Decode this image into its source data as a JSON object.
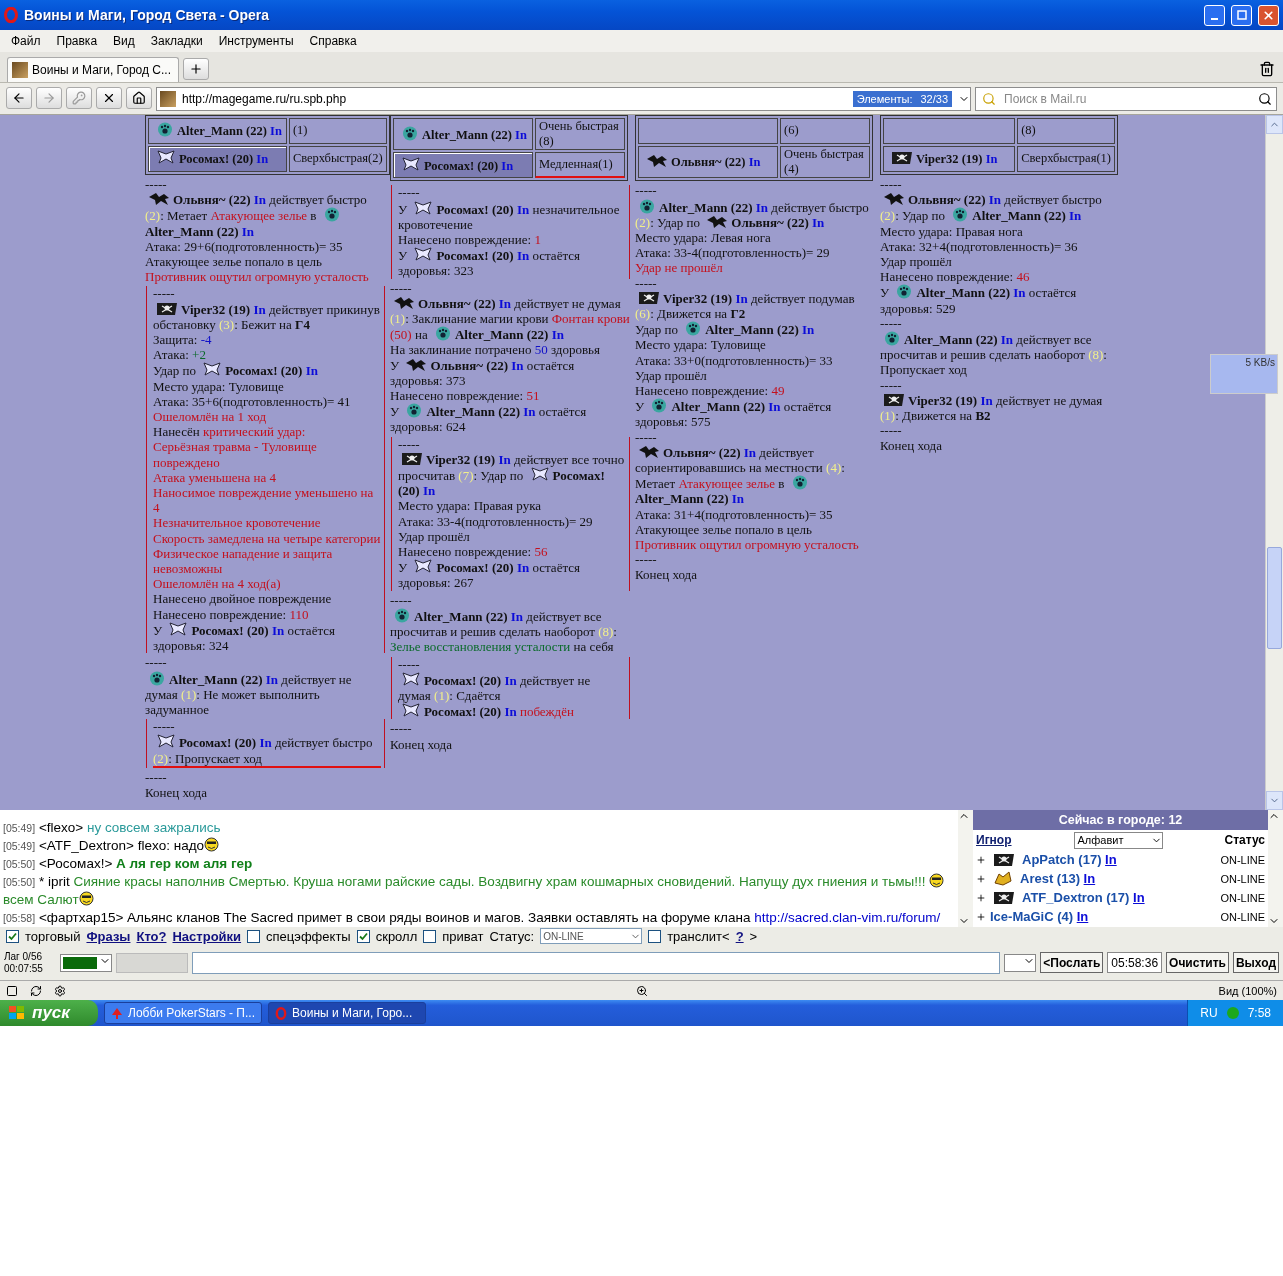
{
  "browser": {
    "title": "Воины и Маги, Город Света - Opera",
    "menu": [
      "Файл",
      "Правка",
      "Вид",
      "Закладки",
      "Инструменты",
      "Справка"
    ],
    "tab": {
      "label": "Воины и Маги, Город С..."
    },
    "address": "http://magegame.ru/ru.spb.php",
    "elements_label": "Элементы:",
    "elements_count": "32/33",
    "search_placeholder": "Поиск в Mail.ru"
  },
  "battle": {
    "columns": [
      {
        "table": [
          {
            "player": {
              "kind": "orb",
              "name": "Alter_Mann (22)",
              "link": "In"
            },
            "speed": "(1)",
            "selected": false,
            "marked": false
          },
          {
            "player": {
              "kind": "moth",
              "name": "Росомах! (20)",
              "link": "In"
            },
            "speed": "Сверхбыстрая(2)",
            "selected": true,
            "marked": false
          }
        ],
        "entries": [
          {
            "kind": "sep",
            "text": "-----"
          },
          {
            "kind": "line",
            "segments": [
              {
                "kind": "dragon_player",
                "name": "Ольвня~ (22)",
                "link": "In"
              },
              {
                "kind": "plain",
                "text": " действует быстро "
              },
              {
                "kind": "num",
                "text": "(2)"
              },
              {
                "kind": "plain",
                "text": ": Метает "
              },
              {
                "kind": "red",
                "text": "Атакующее зелье"
              },
              {
                "kind": "plain",
                "text": " в "
              },
              {
                "kind": "orb_player",
                "name": "Alter_Mann (22)",
                "link": "In"
              }
            ]
          },
          {
            "kind": "line",
            "segments": [
              {
                "kind": "plain",
                "text": "Атака: 29+6(подготовленность)= 35"
              }
            ]
          },
          {
            "kind": "line",
            "segments": [
              {
                "kind": "plain",
                "text": "Атакующее зелье попало в цель"
              }
            ]
          },
          {
            "kind": "line",
            "segments": [
              {
                "kind": "red",
                "text": "Противник ощутил огромную усталость"
              }
            ]
          },
          {
            "kind": "nested",
            "lines": [
              {
                "kind": "sep",
                "text": "-----"
              },
              {
                "kind": "line",
                "segments": [
                  {
                    "kind": "flag_player",
                    "name": "Viper32 (19)",
                    "link": "In"
                  },
                  {
                    "kind": "plain",
                    "text": " действует прикинув обстановку "
                  },
                  {
                    "kind": "num",
                    "text": "(3)"
                  },
                  {
                    "kind": "plain",
                    "text": ": Бежит на "
                  },
                  {
                    "kind": "bold",
                    "text": "Г4"
                  }
                ]
              },
              {
                "kind": "line",
                "segments": [
                  {
                    "kind": "plain",
                    "text": "Защита: "
                  },
                  {
                    "kind": "blue",
                    "text": "-4"
                  }
                ]
              },
              {
                "kind": "line",
                "segments": [
                  {
                    "kind": "plain",
                    "text": "Атака: "
                  },
                  {
                    "kind": "green",
                    "text": "+2"
                  }
                ]
              },
              {
                "kind": "line",
                "segments": [
                  {
                    "kind": "plain",
                    "text": "Удар по "
                  },
                  {
                    "kind": "moth_player",
                    "name": "Росомах! (20)",
                    "link": "In"
                  }
                ]
              },
              {
                "kind": "line",
                "segments": [
                  {
                    "kind": "plain",
                    "text": "Место удара: Туловище"
                  }
                ]
              },
              {
                "kind": "line",
                "segments": [
                  {
                    "kind": "plain",
                    "text": "Атака: 35+6(подготовленность)= 41"
                  }
                ]
              },
              {
                "kind": "line",
                "segments": [
                  {
                    "kind": "red",
                    "text": "Ошеломлён на 1 ход"
                  }
                ]
              },
              {
                "kind": "line",
                "segments": [
                  {
                    "kind": "plain",
                    "text": "Нанесён "
                  },
                  {
                    "kind": "red",
                    "text": "критический удар:"
                  }
                ]
              },
              {
                "kind": "line",
                "segments": [
                  {
                    "kind": "red",
                    "text": "Серьёзная травма - Туловище повреждено"
                  }
                ]
              },
              {
                "kind": "line",
                "segments": [
                  {
                    "kind": "red",
                    "text": "Атака уменьшена на 4"
                  }
                ]
              },
              {
                "kind": "line",
                "segments": [
                  {
                    "kind": "red",
                    "text": "Наносимое повреждение уменьшено на 4"
                  }
                ]
              },
              {
                "kind": "line",
                "segments": [
                  {
                    "kind": "red",
                    "text": "Незначительное кровотечение"
                  }
                ]
              },
              {
                "kind": "line",
                "segments": [
                  {
                    "kind": "red",
                    "text": "Скорость замедлена на четыре категории"
                  }
                ]
              },
              {
                "kind": "line",
                "segments": [
                  {
                    "kind": "red",
                    "text": "Физическое нападение и защита невозможны"
                  }
                ]
              },
              {
                "kind": "line",
                "segments": [
                  {
                    "kind": "red",
                    "text": "Ошеломлён на 4 ход(а)"
                  }
                ]
              },
              {
                "kind": "line",
                "segments": [
                  {
                    "kind": "plain",
                    "text": "Нанесено двойное повреждение"
                  }
                ]
              },
              {
                "kind": "line",
                "segments": [
                  {
                    "kind": "plain",
                    "text": "Нанесено повреждение: "
                  },
                  {
                    "kind": "red",
                    "text": "110"
                  }
                ]
              },
              {
                "kind": "line",
                "segments": [
                  {
                    "kind": "plain",
                    "text": "У "
                  },
                  {
                    "kind": "moth_player",
                    "name": "Росомах! (20)",
                    "link": "In"
                  },
                  {
                    "kind": "plain",
                    "text": " остаётся здоровья: 324"
                  }
                ]
              }
            ]
          },
          {
            "kind": "sep",
            "text": "-----"
          },
          {
            "kind": "line",
            "segments": [
              {
                "kind": "orb_player",
                "name": "Alter_Mann (22)",
                "link": "In"
              },
              {
                "kind": "plain",
                "text": " действует не думая "
              },
              {
                "kind": "num",
                "text": "(1)"
              },
              {
                "kind": "plain",
                "text": ": Не может выполнить задуманное"
              }
            ]
          },
          {
            "kind": "nested",
            "lines": [
              {
                "kind": "sep",
                "text": "-----"
              },
              {
                "kind": "line",
                "marked": true,
                "segments": [
                  {
                    "kind": "moth_player",
                    "name": "Росомах! (20)",
                    "link": "In"
                  },
                  {
                    "kind": "plain",
                    "text": " действует быстро "
                  },
                  {
                    "kind": "num",
                    "text": "(2)"
                  },
                  {
                    "kind": "plain",
                    "text": ": Пропускает ход"
                  }
                ]
              }
            ]
          },
          {
            "kind": "sep",
            "text": "-----"
          },
          {
            "kind": "line",
            "segments": [
              {
                "kind": "plain",
                "text": "Конец хода"
              }
            ]
          }
        ]
      },
      {
        "table": [
          {
            "player": {
              "kind": "orb",
              "name": "Alter_Mann (22)",
              "link": "In"
            },
            "speed": "Очень быстрая (8)",
            "selected": false,
            "marked": false
          },
          {
            "player": {
              "kind": "moth",
              "name": "Росомах! (20)",
              "link": "In"
            },
            "speed": "Медленная(1)",
            "selected": true,
            "marked": true
          }
        ],
        "entries": [
          {
            "kind": "nested",
            "lines": [
              {
                "kind": "sep",
                "text": "-----"
              },
              {
                "kind": "line",
                "segments": [
                  {
                    "kind": "plain",
                    "text": "У "
                  },
                  {
                    "kind": "moth_player",
                    "name": "Росомах! (20)",
                    "link": "In"
                  },
                  {
                    "kind": "plain",
                    "text": " незначительное кровотечение"
                  }
                ]
              },
              {
                "kind": "line",
                "segments": [
                  {
                    "kind": "plain",
                    "text": "Нанесено повреждение: "
                  },
                  {
                    "kind": "red",
                    "text": "1"
                  }
                ]
              },
              {
                "kind": "line",
                "segments": [
                  {
                    "kind": "plain",
                    "text": "У "
                  },
                  {
                    "kind": "moth_player",
                    "name": "Росомах! (20)",
                    "link": "In"
                  },
                  {
                    "kind": "plain",
                    "text": " остаётся здоровья: 323"
                  }
                ]
              }
            ]
          },
          {
            "kind": "sep",
            "text": "-----"
          },
          {
            "kind": "line",
            "segments": [
              {
                "kind": "dragon_player",
                "name": "Ольвня~ (22)",
                "link": "In"
              },
              {
                "kind": "plain",
                "text": " действует не думая "
              },
              {
                "kind": "num",
                "text": "(1)"
              },
              {
                "kind": "plain",
                "text": ": Заклинание магии крови "
              },
              {
                "kind": "red",
                "text": "Фонтан крови (50)"
              },
              {
                "kind": "plain",
                "text": " на "
              },
              {
                "kind": "orb_player",
                "name": "Alter_Mann (22)",
                "link": "In"
              }
            ]
          },
          {
            "kind": "line",
            "segments": [
              {
                "kind": "plain",
                "text": "На заклинание потрачено "
              },
              {
                "kind": "blue",
                "text": "50"
              },
              {
                "kind": "plain",
                "text": " здоровья"
              }
            ]
          },
          {
            "kind": "line",
            "segments": [
              {
                "kind": "plain",
                "text": "У "
              },
              {
                "kind": "dragon_player",
                "name": "Ольвня~ (22)",
                "link": "In"
              },
              {
                "kind": "plain",
                "text": " остаётся здоровья: 373"
              }
            ]
          },
          {
            "kind": "line",
            "segments": [
              {
                "kind": "plain",
                "text": "Нанесено повреждение: "
              },
              {
                "kind": "red",
                "text": "51"
              }
            ]
          },
          {
            "kind": "line",
            "segments": [
              {
                "kind": "plain",
                "text": "У "
              },
              {
                "kind": "orb_player",
                "name": "Alter_Mann (22)",
                "link": "In"
              },
              {
                "kind": "plain",
                "text": " остаётся здоровья: 624"
              }
            ]
          },
          {
            "kind": "nested",
            "lines": [
              {
                "kind": "sep",
                "text": "-----"
              },
              {
                "kind": "line",
                "segments": [
                  {
                    "kind": "flag_player",
                    "name": "Viper32 (19)",
                    "link": "In"
                  },
                  {
                    "kind": "plain",
                    "text": " действует все точно просчитав "
                  },
                  {
                    "kind": "num",
                    "text": "(7)"
                  },
                  {
                    "kind": "plain",
                    "text": ": Удар по "
                  },
                  {
                    "kind": "moth_player",
                    "name": "Росомах! (20)",
                    "link": "In"
                  }
                ]
              },
              {
                "kind": "line",
                "segments": [
                  {
                    "kind": "plain",
                    "text": "Место удара: Правая рука"
                  }
                ]
              },
              {
                "kind": "line",
                "segments": [
                  {
                    "kind": "plain",
                    "text": "Атака: 33-4(подготовленность)= 29"
                  }
                ]
              },
              {
                "kind": "line",
                "segments": [
                  {
                    "kind": "plain",
                    "text": "Удар прошёл"
                  }
                ]
              },
              {
                "kind": "line",
                "segments": [
                  {
                    "kind": "plain",
                    "text": "Нанесено повреждение: "
                  },
                  {
                    "kind": "red",
                    "text": "56"
                  }
                ]
              },
              {
                "kind": "line",
                "segments": [
                  {
                    "kind": "plain",
                    "text": "У "
                  },
                  {
                    "kind": "moth_player",
                    "name": "Росомах! (20)",
                    "link": "In"
                  },
                  {
                    "kind": "plain",
                    "text": " остаётся здоровья: 267"
                  }
                ]
              }
            ]
          },
          {
            "kind": "sep",
            "text": "-----"
          },
          {
            "kind": "line",
            "segments": [
              {
                "kind": "orb_player",
                "name": "Alter_Mann (22)",
                "link": "In"
              },
              {
                "kind": "plain",
                "text": " действует все просчитав и решив сделать наоборот "
              },
              {
                "kind": "num",
                "text": "(8)"
              },
              {
                "kind": "plain",
                "text": ":"
              }
            ]
          },
          {
            "kind": "line",
            "segments": [
              {
                "kind": "green",
                "text": "Зелье восстановления усталости"
              },
              {
                "kind": "plain",
                "text": " на себя"
              }
            ]
          },
          {
            "kind": "nested",
            "lines": [
              {
                "kind": "sep",
                "text": "-----"
              },
              {
                "kind": "line",
                "segments": [
                  {
                    "kind": "moth_player",
                    "name": "Росомах! (20)",
                    "link": "In"
                  },
                  {
                    "kind": "plain",
                    "text": " действует не думая "
                  },
                  {
                    "kind": "num",
                    "text": "(1)"
                  },
                  {
                    "kind": "plain",
                    "text": ": Сдаётся"
                  }
                ]
              },
              {
                "kind": "line",
                "segments": [
                  {
                    "kind": "moth_player",
                    "name": "Росомах! (20)",
                    "link": "In"
                  },
                  {
                    "kind": "red",
                    "text": " побеждён"
                  }
                ]
              }
            ]
          },
          {
            "kind": "sep",
            "text": "-----"
          },
          {
            "kind": "line",
            "segments": [
              {
                "kind": "plain",
                "text": "Конец хода"
              }
            ]
          }
        ]
      },
      {
        "table": [
          {
            "speed": "(6)",
            "selected": false,
            "marked": false
          },
          {
            "player": {
              "kind": "dragon",
              "name": "Ольвня~ (22)",
              "link": "In"
            },
            "speed": "Очень быстрая (4)",
            "selected": false,
            "marked": false
          }
        ],
        "entries": [
          {
            "kind": "sep",
            "text": "-----"
          },
          {
            "kind": "line",
            "segments": [
              {
                "kind": "orb_player",
                "name": "Alter_Mann (22)",
                "link": "In"
              },
              {
                "kind": "plain",
                "text": " действует быстро "
              },
              {
                "kind": "num",
                "text": "(2)"
              },
              {
                "kind": "plain",
                "text": ": Удар по "
              },
              {
                "kind": "dragon_player",
                "name": "Ольвня~ (22)",
                "link": "In"
              }
            ]
          },
          {
            "kind": "line",
            "segments": [
              {
                "kind": "plain",
                "text": "Место удара: Левая нога"
              }
            ]
          },
          {
            "kind": "line",
            "segments": [
              {
                "kind": "plain",
                "text": "Атака: 33-4(подготовленность)= 29"
              }
            ]
          },
          {
            "kind": "line",
            "segments": [
              {
                "kind": "red",
                "text": "Удар не прошёл"
              }
            ]
          },
          {
            "kind": "sep",
            "text": "-----"
          },
          {
            "kind": "line",
            "segments": [
              {
                "kind": "flag_player",
                "name": "Viper32 (19)",
                "link": "In"
              },
              {
                "kind": "plain",
                "text": " действует подумав "
              },
              {
                "kind": "num",
                "text": "(6)"
              },
              {
                "kind": "plain",
                "text": ": Движется на "
              },
              {
                "kind": "bold",
                "text": "Г2"
              }
            ]
          },
          {
            "kind": "line",
            "segments": [
              {
                "kind": "plain",
                "text": "Удар по "
              },
              {
                "kind": "orb_player",
                "name": "Alter_Mann (22)",
                "link": "In"
              }
            ]
          },
          {
            "kind": "line",
            "segments": [
              {
                "kind": "plain",
                "text": "Место удара: Туловище"
              }
            ]
          },
          {
            "kind": "line",
            "segments": [
              {
                "kind": "plain",
                "text": "Атака: 33+0(подготовленность)= 33"
              }
            ]
          },
          {
            "kind": "line",
            "segments": [
              {
                "kind": "plain",
                "text": "Удар прошёл"
              }
            ]
          },
          {
            "kind": "line",
            "segments": [
              {
                "kind": "plain",
                "text": "Нанесено повреждение: "
              },
              {
                "kind": "red",
                "text": "49"
              }
            ]
          },
          {
            "kind": "line",
            "segments": [
              {
                "kind": "plain",
                "text": "У "
              },
              {
                "kind": "orb_player",
                "name": "Alter_Mann (22)",
                "link": "In"
              },
              {
                "kind": "plain",
                "text": " остаётся здоровья: 575"
              }
            ]
          },
          {
            "kind": "sep",
            "text": "-----"
          },
          {
            "kind": "line",
            "segments": [
              {
                "kind": "dragon_player",
                "name": "Ольвня~ (22)",
                "link": "In"
              },
              {
                "kind": "plain",
                "text": " действует сориентировавшись на местности "
              },
              {
                "kind": "num",
                "text": "(4)"
              },
              {
                "kind": "plain",
                "text": ": Метает "
              },
              {
                "kind": "red",
                "text": "Атакующее зелье"
              },
              {
                "kind": "plain",
                "text": " в "
              },
              {
                "kind": "orb_player",
                "name": "Alter_Mann (22)",
                "link": "In"
              }
            ]
          },
          {
            "kind": "line",
            "segments": [
              {
                "kind": "plain",
                "text": "Атака: 31+4(подготовленность)= 35"
              }
            ]
          },
          {
            "kind": "line",
            "segments": [
              {
                "kind": "plain",
                "text": "Атакующее зелье попало в цель"
              }
            ]
          },
          {
            "kind": "line",
            "segments": [
              {
                "kind": "red",
                "text": "Противник ощутил огромную усталость"
              }
            ]
          },
          {
            "kind": "sep",
            "text": "-----"
          },
          {
            "kind": "line",
            "segments": [
              {
                "kind": "plain",
                "text": "Конец хода"
              }
            ]
          }
        ]
      },
      {
        "table": [
          {
            "speed": "(8)",
            "selected": false,
            "marked": false
          },
          {
            "player": {
              "kind": "flag",
              "name": "Viper32 (19)",
              "link": "In"
            },
            "speed": "Сверхбыстрая(1)",
            "selected": false,
            "marked": false
          }
        ],
        "entries": [
          {
            "kind": "sep",
            "text": "-----"
          },
          {
            "kind": "line",
            "segments": [
              {
                "kind": "dragon_player",
                "name": "Ольвня~ (22)",
                "link": "In"
              },
              {
                "kind": "plain",
                "text": " действует быстро "
              },
              {
                "kind": "num",
                "text": "(2)"
              },
              {
                "kind": "plain",
                "text": ": Удар по "
              },
              {
                "kind": "orb_player",
                "name": "Alter_Mann (22)",
                "link": "In"
              }
            ]
          },
          {
            "kind": "line",
            "segments": [
              {
                "kind": "plain",
                "text": "Место удара: Правая нога"
              }
            ]
          },
          {
            "kind": "line",
            "segments": [
              {
                "kind": "plain",
                "text": "Атака: 32+4(подготовленность)= 36"
              }
            ]
          },
          {
            "kind": "line",
            "segments": [
              {
                "kind": "plain",
                "text": "Удар прошёл"
              }
            ]
          },
          {
            "kind": "line",
            "segments": [
              {
                "kind": "plain",
                "text": "Нанесено повреждение: "
              },
              {
                "kind": "red",
                "text": "46"
              }
            ]
          },
          {
            "kind": "line",
            "segments": [
              {
                "kind": "plain",
                "text": "У "
              },
              {
                "kind": "orb_player",
                "name": "Alter_Mann (22)",
                "link": "In"
              },
              {
                "kind": "plain",
                "text": " остаётся здоровья: 529"
              }
            ]
          },
          {
            "kind": "sep",
            "text": "-----"
          },
          {
            "kind": "line",
            "segments": [
              {
                "kind": "orb_player",
                "name": "Alter_Mann (22)",
                "link": "In"
              },
              {
                "kind": "plain",
                "text": " действует все просчитав и решив сделать наоборот "
              },
              {
                "kind": "num",
                "text": "(8)"
              },
              {
                "kind": "plain",
                "text": ": Пропускает ход"
              }
            ]
          },
          {
            "kind": "sep",
            "text": "-----"
          },
          {
            "kind": "line",
            "segments": [
              {
                "kind": "flag_player",
                "name": "Viper32 (19)",
                "link": "In"
              },
              {
                "kind": "plain",
                "text": " действует не думая "
              },
              {
                "kind": "num",
                "text": "(1)"
              },
              {
                "kind": "plain",
                "text": ": Движется на "
              },
              {
                "kind": "bold",
                "text": "В2"
              }
            ]
          },
          {
            "kind": "sep",
            "text": "-----"
          },
          {
            "kind": "line",
            "segments": [
              {
                "kind": "plain",
                "text": "Конец хода"
              }
            ]
          }
        ]
      }
    ]
  },
  "traffic_widget": {
    "speed": "5 KB/s"
  },
  "chat": {
    "messages": [
      {
        "time": "[05:49]",
        "nick": "<flexo>",
        "segments": [
          {
            "kind": "teal",
            "text": " ну совсем зажрались"
          }
        ]
      },
      {
        "time": "[05:49]",
        "nick": "<ATF_Dextron>",
        "segments": [
          {
            "kind": "plain",
            "text": " flexo: надо"
          },
          {
            "kind": "smiley"
          }
        ]
      },
      {
        "time": "[05:50]",
        "nick": "<Росомах!>",
        "segments": [
          {
            "kind": "greenbold",
            "text": " А ля гер ком аля гер"
          }
        ]
      },
      {
        "time": "[05:50]",
        "nick": "* iprit",
        "segments": [
          {
            "kind": "green",
            "text": " Сияние красы наполнив Смертью. Круша ногами райские сады. Воздвигну храм кошмарных сновидений. Напущу дух гниения и тьмы!!! "
          },
          {
            "kind": "smiley"
          },
          {
            "kind": "green",
            "text": " всем Салют"
          },
          {
            "kind": "smiley"
          }
        ]
      },
      {
        "time": "[05:58]",
        "nick": "<фартхар15>",
        "segments": [
          {
            "kind": "plain",
            "text": " Альянс кланов The Sacred примет в свои ряды воинов и магов. Заявки оставлять на форуме клана "
          },
          {
            "kind": "link",
            "text": "http://sacred.clan-vim.ru/forum/"
          }
        ]
      }
    ]
  },
  "users_panel": {
    "title": "Сейчас в городе: 12",
    "ignore": "Игнор",
    "sort": "Алфавит",
    "status_header": "Статус",
    "users": [
      {
        "kind": "flag",
        "name": "ApPatch (17)",
        "link": "In",
        "status": "ON-LINE"
      },
      {
        "kind": "beast",
        "name": "Arest (13)",
        "link": "In",
        "status": "ON-LINE"
      },
      {
        "kind": "flag",
        "name": "ATF_Dextron (17)",
        "link": "In",
        "status": "ON-LINE"
      },
      {
        "kind": "plain",
        "name": "Ice-MaGiC (4)",
        "link": "In",
        "status": "ON-LINE"
      }
    ]
  },
  "controls": [
    {
      "kind": "checkbox",
      "label": "торговый",
      "checked": true
    },
    {
      "kind": "link",
      "label": "Фразы"
    },
    {
      "kind": "link",
      "label": "Кто?"
    },
    {
      "kind": "link",
      "label": "Настройки"
    },
    {
      "kind": "checkbox",
      "label": "спецэффекты",
      "checked": false
    },
    {
      "kind": "checkbox",
      "label": "скролл",
      "checked": true
    },
    {
      "kind": "checkbox",
      "label": "приват",
      "checked": false
    },
    {
      "kind": "label",
      "label": "Статус:"
    },
    {
      "kind": "select",
      "label": "ON-LINE"
    },
    {
      "kind": "checkbox",
      "label": "транслит<",
      "checked": false
    },
    {
      "kind": "link",
      "label": "?"
    },
    {
      "kind": "label",
      "label": ">"
    }
  ],
  "input_row": {
    "lag": "Лаг 0/56",
    "timer": "00:07:55",
    "send": "<Послать",
    "clock": "05:58:36",
    "clear": "Очистить",
    "exit": "Выход"
  },
  "status_bar": {
    "zoom": "Вид (100%)"
  },
  "taskbar": {
    "start": "пуск",
    "tasks": [
      {
        "kind": "lobby",
        "label": "Лобби PokerStars - П...",
        "selected": false
      },
      {
        "kind": "browser",
        "label": "Воины и Маги, Горо...",
        "selected": true
      }
    ],
    "lang": "RU",
    "time": "7:58"
  }
}
